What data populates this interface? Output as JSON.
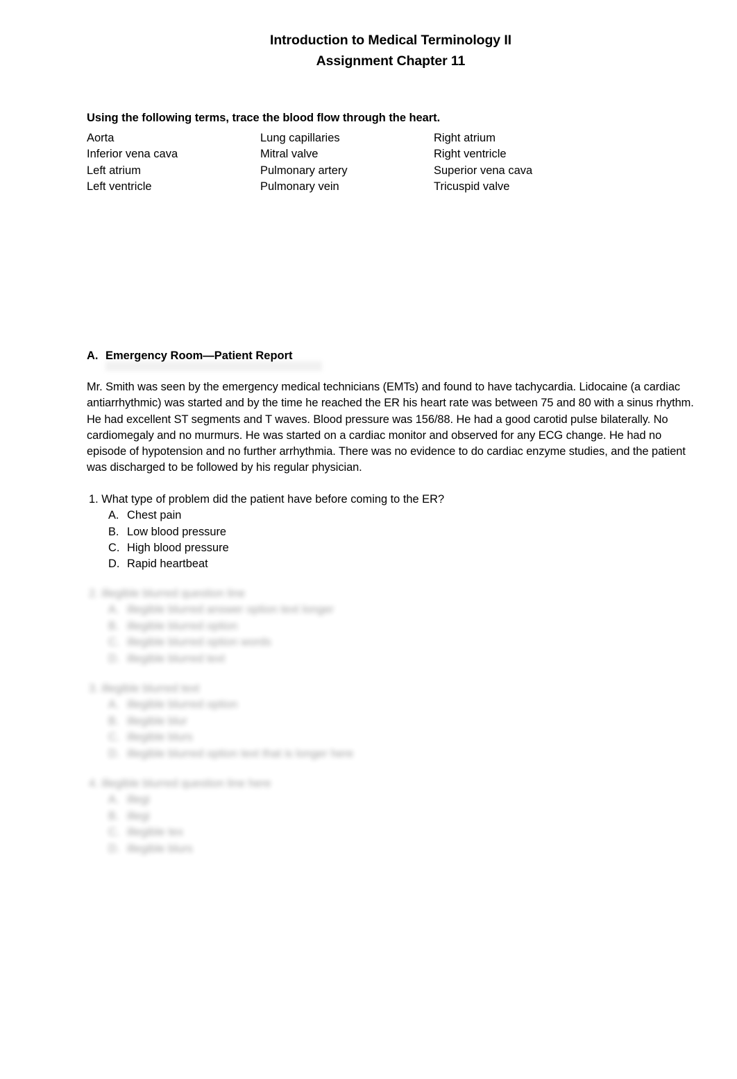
{
  "document": {
    "title_lines": [
      "Introduction to Medical Terminology II",
      "Assignment Chapter 11"
    ],
    "instruction": "Using the following terms, trace the blood flow through the heart.",
    "terms": [
      "Aorta",
      "Lung capillaries",
      "Right atrium",
      "Inferior vena cava",
      "Mitral valve",
      "Right ventricle",
      "Left atrium",
      "Pulmonary artery",
      "Superior vena cava",
      "Left ventricle",
      "Pulmonary vein",
      "Tricuspid valve"
    ],
    "section": {
      "letter": "A.",
      "heading": "Emergency Room—Patient Report",
      "report": "Mr. Smith was seen by the emergency medical technicians (EMTs) and found to have tachycardia. Lidocaine (a cardiac antiarrhythmic) was started and by the time he reached the ER his heart rate was between 75 and 80 with a sinus rhythm.  He had excellent ST segments and T waves.  Blood pressure was 156/88. He had a good carotid pulse bilaterally.  No cardiomegaly and no murmurs.  He was started on a cardiac monitor and observed for any ECG change.  He had no episode of hypotension and no further arrhythmia.  There was no evidence to do cardiac enzyme studies, and the patient was discharged to be followed by his regular physician."
    },
    "questions": [
      {
        "number": "1.",
        "text": "What type of problem did the patient have before coming to the ER?",
        "blurred": false,
        "options": [
          {
            "letter": "A.",
            "text": "Chest pain"
          },
          {
            "letter": "B.",
            "text": "Low blood pressure"
          },
          {
            "letter": "C.",
            "text": "High blood pressure"
          },
          {
            "letter": "D.",
            "text": "Rapid heartbeat"
          }
        ]
      },
      {
        "number": "2.",
        "text": "illegible blurred question line",
        "blurred": true,
        "options": [
          {
            "letter": "A.",
            "text": "illegible blurred answer option text longer"
          },
          {
            "letter": "B.",
            "text": "illegible blurred option"
          },
          {
            "letter": "C.",
            "text": "illegible blurred option words"
          },
          {
            "letter": "D.",
            "text": "illegible blurred text"
          }
        ]
      },
      {
        "number": "3.",
        "text": "illegible blurred text",
        "blurred": true,
        "options": [
          {
            "letter": "A.",
            "text": "illegible blurred option"
          },
          {
            "letter": "B.",
            "text": "illegible blur"
          },
          {
            "letter": "C.",
            "text": "illegible blurs"
          },
          {
            "letter": "D.",
            "text": "illegible blurred option text that is longer here"
          }
        ]
      },
      {
        "number": "4.",
        "text": "illegible blurred question line here",
        "blurred": true,
        "options": [
          {
            "letter": "A.",
            "text": "illegi"
          },
          {
            "letter": "B.",
            "text": "illegi"
          },
          {
            "letter": "C.",
            "text": "illegible tex"
          },
          {
            "letter": "D.",
            "text": "illegible blurs"
          }
        ]
      }
    ]
  }
}
